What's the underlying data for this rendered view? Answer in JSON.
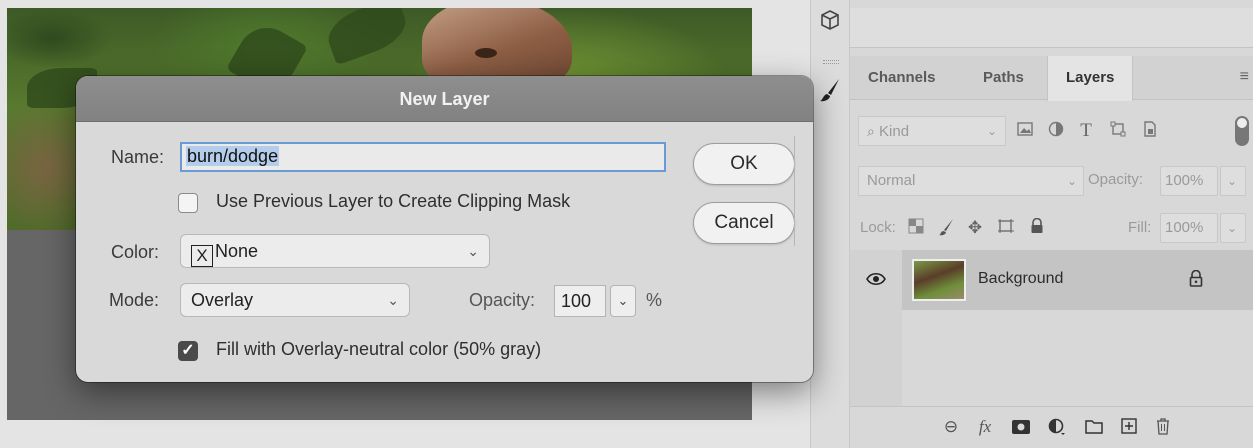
{
  "dialog": {
    "title": "New Layer",
    "name_label": "Name:",
    "name_value": "burn/dodge",
    "clipping_mask_label": "Use Previous Layer to Create Clipping Mask",
    "clipping_mask_checked": false,
    "color_label": "Color:",
    "color_value": "None",
    "color_swatch_glyph": "X",
    "mode_label": "Mode:",
    "mode_value": "Overlay",
    "opacity_label": "Opacity:",
    "opacity_value": "100",
    "opacity_unit": "%",
    "fill_label": "Fill with Overlay-neutral color (50% gray)",
    "fill_checked": true,
    "ok_label": "OK",
    "cancel_label": "Cancel"
  },
  "layers_panel": {
    "tabs": [
      {
        "label": "Channels",
        "active": false
      },
      {
        "label": "Paths",
        "active": false
      },
      {
        "label": "Layers",
        "active": true
      }
    ],
    "filter_kind": "Kind",
    "blend_mode": "Normal",
    "opacity_label": "Opacity:",
    "opacity_value": "100%",
    "lock_label": "Lock:",
    "fill_label": "Fill:",
    "fill_value": "100%",
    "layers": [
      {
        "name": "Background",
        "visible": true,
        "locked": true
      }
    ]
  },
  "icons": {
    "toolbar": [
      "3d-cube-icon",
      "brush-icon"
    ],
    "filter": [
      "search-icon",
      "image-filter-icon",
      "adjustment-filter-icon",
      "type-filter-icon",
      "shape-filter-icon",
      "smart-object-filter-icon"
    ],
    "lock": [
      "lock-pixels-icon",
      "lock-image-icon",
      "lock-position-icon",
      "lock-artboard-icon",
      "lock-all-icon"
    ],
    "bottom": [
      "link-layers-icon",
      "fx-icon",
      "mask-icon",
      "adjustment-layer-icon",
      "group-folder-icon",
      "new-layer-icon",
      "trash-icon"
    ]
  },
  "colors": {
    "dialog_title_bg": "#888888",
    "focus_ring": "#6a9ad4",
    "selection": "#b3cdea"
  }
}
